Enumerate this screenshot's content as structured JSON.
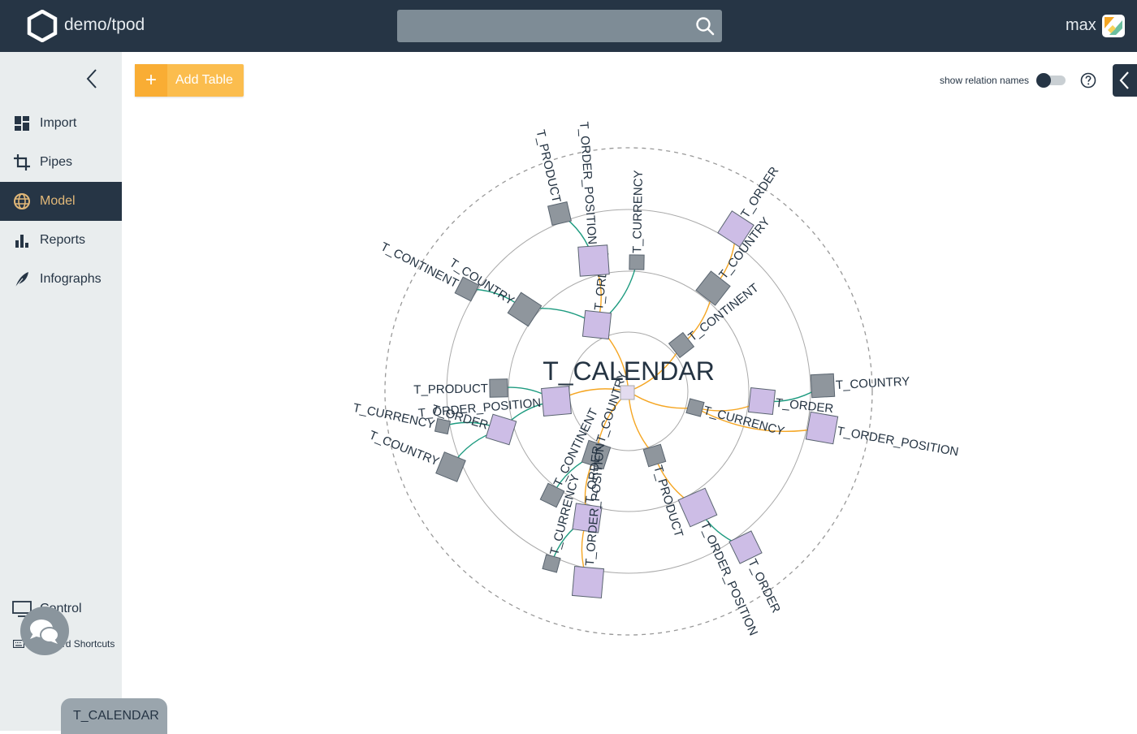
{
  "header": {
    "project": "demo/tpod",
    "user": "max",
    "search_placeholder": ""
  },
  "sidebar": {
    "items": [
      {
        "label": "Import",
        "icon": "dashboard-icon",
        "active": false
      },
      {
        "label": "Pipes",
        "icon": "crop-icon",
        "active": false
      },
      {
        "label": "Model",
        "icon": "globe-icon",
        "active": true
      },
      {
        "label": "Reports",
        "icon": "bar-chart-icon",
        "active": false
      },
      {
        "label": "Infographs",
        "icon": "feather-icon",
        "active": false
      }
    ],
    "control": "Control",
    "shortcuts": "Keyboard Shortcuts",
    "open_tab": "T_CALENDAR"
  },
  "toolbar": {
    "add_table": "Add Table",
    "show_relation_names": "show relation names",
    "show_relation_names_on": false
  },
  "graph": {
    "center": "T_CALENDAR",
    "nodes": [
      {
        "id": "o1",
        "label": "T_ORDER",
        "kind": "table"
      },
      {
        "id": "op1",
        "label": "T_ORDER_POSITION",
        "kind": "table"
      },
      {
        "id": "p1",
        "label": "T_PRODUCT",
        "kind": "reference"
      },
      {
        "id": "cur1",
        "label": "T_CURRENCY",
        "kind": "reference"
      },
      {
        "id": "cty1",
        "label": "T_COUNTRY",
        "kind": "reference"
      },
      {
        "id": "con1",
        "label": "T_CONTINENT",
        "kind": "reference"
      },
      {
        "id": "o2",
        "label": "T_ORDER",
        "kind": "table"
      },
      {
        "id": "cty2",
        "label": "T_COUNTRY",
        "kind": "reference"
      },
      {
        "id": "con2",
        "label": "T_CONTINENT",
        "kind": "reference"
      },
      {
        "id": "o3",
        "label": "T_ORDER",
        "kind": "table"
      },
      {
        "id": "op3",
        "label": "T_ORDER_POSITION",
        "kind": "table"
      },
      {
        "id": "cty3",
        "label": "T_COUNTRY",
        "kind": "reference"
      },
      {
        "id": "cur3",
        "label": "T_CURRENCY",
        "kind": "reference"
      },
      {
        "id": "p4",
        "label": "T_PRODUCT",
        "kind": "reference"
      },
      {
        "id": "op4",
        "label": "T_ORDER_POSITION",
        "kind": "table"
      },
      {
        "id": "o4",
        "label": "T_ORDER",
        "kind": "table"
      },
      {
        "id": "cty5",
        "label": "T_COUNTRY",
        "kind": "reference"
      },
      {
        "id": "o5",
        "label": "T_ORDER",
        "kind": "table"
      },
      {
        "id": "op5",
        "label": "T_ORDER_POSITION",
        "kind": "table"
      },
      {
        "id": "con5",
        "label": "T_CONTINENT",
        "kind": "reference"
      },
      {
        "id": "cur5",
        "label": "T_CURRENCY",
        "kind": "reference"
      },
      {
        "id": "p6",
        "label": "T_PRODUCT",
        "kind": "reference"
      },
      {
        "id": "op6",
        "label": "T_ORDER_POSITION",
        "kind": "table"
      },
      {
        "id": "o6",
        "label": "T_ORDER",
        "kind": "table"
      },
      {
        "id": "cur6",
        "label": "T_CURRENCY",
        "kind": "reference"
      },
      {
        "id": "cty6",
        "label": "T_COUNTRY",
        "kind": "reference"
      }
    ],
    "edges": [
      {
        "from": "center",
        "to": "o1",
        "kind": "orange"
      },
      {
        "from": "o1",
        "to": "op1",
        "kind": "orange"
      },
      {
        "from": "op1",
        "to": "p1",
        "kind": "green"
      },
      {
        "from": "o1",
        "to": "cur1",
        "kind": "green"
      },
      {
        "from": "o1",
        "to": "cty1",
        "kind": "green"
      },
      {
        "from": "cty1",
        "to": "con1",
        "kind": "green"
      },
      {
        "from": "center",
        "to": "con2",
        "kind": "orange"
      },
      {
        "from": "con2",
        "to": "cty2",
        "kind": "orange"
      },
      {
        "from": "cty2",
        "to": "o2",
        "kind": "orange"
      },
      {
        "from": "center",
        "to": "cur3",
        "kind": "orange"
      },
      {
        "from": "cur3",
        "to": "o3",
        "kind": "orange"
      },
      {
        "from": "cur3",
        "to": "op3",
        "kind": "orange"
      },
      {
        "from": "o3",
        "to": "cty3",
        "kind": "green"
      },
      {
        "from": "center",
        "to": "p4",
        "kind": "orange"
      },
      {
        "from": "p4",
        "to": "op4",
        "kind": "orange"
      },
      {
        "from": "op4",
        "to": "o4",
        "kind": "green"
      },
      {
        "from": "center",
        "to": "cty5",
        "kind": "orange"
      },
      {
        "from": "cty5",
        "to": "o5",
        "kind": "orange"
      },
      {
        "from": "o5",
        "to": "op5",
        "kind": "orange"
      },
      {
        "from": "cty5",
        "to": "con5",
        "kind": "green"
      },
      {
        "from": "o5",
        "to": "cur5",
        "kind": "green"
      },
      {
        "from": "center",
        "to": "op6",
        "kind": "orange"
      },
      {
        "from": "op6",
        "to": "p6",
        "kind": "green"
      },
      {
        "from": "op6",
        "to": "o6",
        "kind": "green"
      },
      {
        "from": "o6",
        "to": "cur6",
        "kind": "green"
      },
      {
        "from": "o6",
        "to": "cty6",
        "kind": "green"
      }
    ]
  },
  "colors": {
    "topbar": "#263545",
    "sidebar": "#e9edee",
    "active_text": "#e2b878",
    "add_button": "#fbbd4e",
    "table_node": "#cdbde6",
    "reference_node": "#8f969d",
    "relation_orange": "#f5a623",
    "relation_green": "#1e9b80"
  }
}
